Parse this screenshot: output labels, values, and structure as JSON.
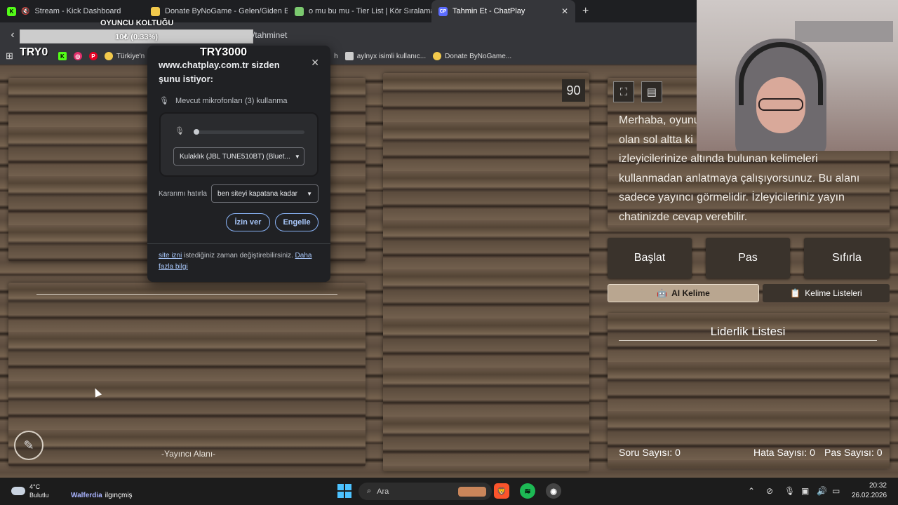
{
  "browser": {
    "tabs": [
      {
        "label": "Stream - Kick Dashboard",
        "favicon": "K",
        "color": "#53fc18"
      },
      {
        "label": "Donate ByNoGame - Gelen/Giden Ba",
        "favicon": "🐱",
        "color": "#f2c94c"
      },
      {
        "label": "o mu bu mu - Tier List | Kör Sıralama",
        "favicon": "▲",
        "color": "#7bc96f"
      },
      {
        "label": "Tahmin Et - ChatPlay",
        "favicon": "CP",
        "color": "#5b6cff"
      }
    ],
    "new_tab": "+",
    "close": "✕",
    "url_tail": "/tahminet",
    "bookmarks": [
      {
        "label": "Türkiye'n",
        "color": "#f2c94c"
      },
      {
        "label": "h",
        "color": ""
      },
      {
        "label": "aylnyx isimli kullanıc...",
        "color": "#cccccc"
      },
      {
        "label": "Donate ByNoGame...",
        "color": "#f2c94c"
      }
    ]
  },
  "overlay": {
    "seat_title": "OYUNCU KOLTUĞU",
    "progress_text": "10₺ (0.33%)",
    "progress": 0.0033,
    "left_code": "TRY0",
    "right_code": "TRY3000"
  },
  "permission_dialog": {
    "title": "www.chatplay.com.tr sizden şunu istiyor:",
    "mic_request": "Mevcut mikrofonları (3) kullanma",
    "device": "Kulaklık (JBL TUNE510BT) (Bluet...",
    "remember_label": "Kararımı hatırla",
    "remember_value": "ben siteyi kapatana kadar",
    "allow": "İzin ver",
    "block": "Engelle",
    "footer_link1": "site izni",
    "footer_text": " istediğiniz zaman değiştirebilirsiniz. ",
    "footer_link2": "Daha fazla bilgi"
  },
  "game": {
    "timer": "90",
    "streamer_area": "-Yayıncı Alanı-",
    "info": "Merhaba, oyunu olan sol altta ki izleyicilerinize altında bulunan kelimeleri kullanmadan anlatmaya çalışıyorsunuz. Bu alanı sadece yayıncı görmelidir. İzleyicileriniz yayın chatinizde cevap verebilir.",
    "info_lines": [
      "Merhaba, oyunu",
      "olan sol altta ki",
      "izleyicilerinize altında bulunan kelimeleri",
      "kullanmadan anlatmaya çalışıyorsunuz. Bu alanı",
      "sadece yayıncı görmelidir. İzleyicileriniz yayın",
      "chatinizde cevap verebilir."
    ],
    "buttons": {
      "start": "Başlat",
      "pass": "Pas",
      "reset": "Sıfırla"
    },
    "tabs": {
      "ai": "AI Kelime",
      "lists": "Kelime Listeleri"
    },
    "leaderboard_title": "Liderlik Listesi",
    "stats": {
      "questions": "Soru Sayısı: 0",
      "errors": "Hata Sayısı: 0",
      "passes": "Pas Sayısı: 0"
    }
  },
  "taskbar": {
    "temp": "4°C",
    "weather": "Bulutlu",
    "now_playing_artist": "Walferdia",
    "now_playing_title": "ilgınçmiş",
    "search_placeholder": "Ara",
    "time": "20:32",
    "date": "26.02.2026"
  }
}
